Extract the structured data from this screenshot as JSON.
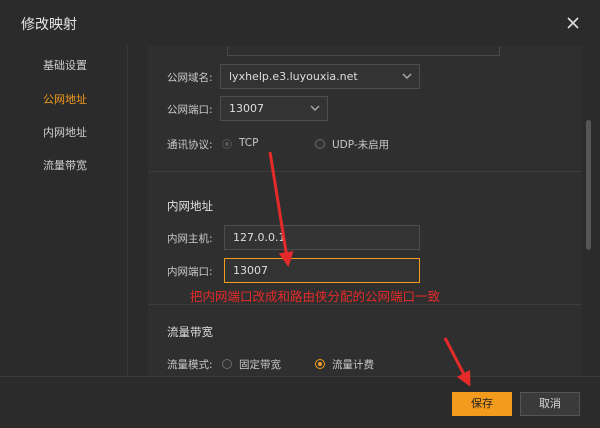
{
  "window": {
    "title": "修改映射"
  },
  "sidebar": {
    "items": [
      {
        "label": "基础设置",
        "active": false
      },
      {
        "label": "公网地址",
        "active": true
      },
      {
        "label": "内网地址",
        "active": false
      },
      {
        "label": "流量带宽",
        "active": false
      }
    ]
  },
  "public": {
    "domain_label": "公网域名:",
    "domain_value": "lyxhelp.e3.luyouxia.net",
    "port_label": "公网端口:",
    "port_value": "13007",
    "protocol_label": "通讯协议:",
    "protocol_tcp": "TCP",
    "protocol_udp": "UDP-未启用"
  },
  "intranet": {
    "section_title": "内网地址",
    "host_label": "内网主机:",
    "host_value": "127.0.0.1",
    "port_label": "内网端口:",
    "port_value": "13007"
  },
  "bandwidth": {
    "section_title": "流量带宽",
    "mode_label": "流量模式:",
    "mode_fixed": "固定带宽",
    "mode_metered": "流量计费"
  },
  "annotation": {
    "text": "把内网端口改成和路由侠分配的公网端口一致",
    "color": "#e52a2a"
  },
  "footer": {
    "save_label": "保存",
    "cancel_label": "取消"
  },
  "colors": {
    "accent": "#f29b1d",
    "background": "#2b2b2b"
  }
}
